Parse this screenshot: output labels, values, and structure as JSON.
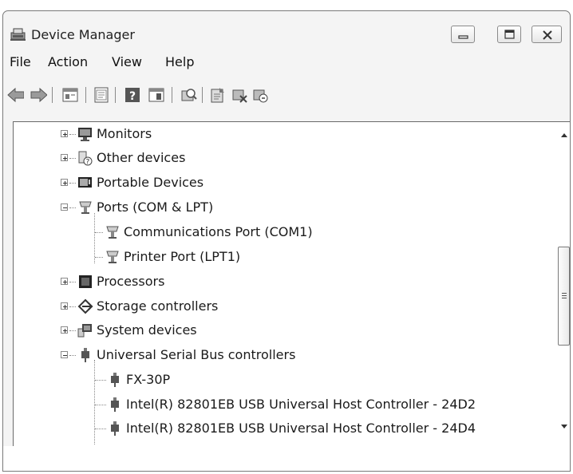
{
  "window": {
    "title": "Device Manager"
  },
  "menu": {
    "items": [
      "File",
      "Action",
      "View",
      "Help"
    ]
  },
  "toolbar": {
    "buttons": [
      "back-arrow-icon",
      "forward-arrow-icon",
      "up-level-icon",
      "properties-icon",
      "help-icon",
      "show-hide-icon",
      "scan-hardware-icon",
      "update-driver-icon",
      "disable-device-icon",
      "uninstall-device-icon"
    ]
  },
  "tree": {
    "rows": [
      {
        "label": "Monitors",
        "icon": "monitor-icon",
        "expanded": false
      },
      {
        "label": "Other devices",
        "icon": "unknown-device-icon",
        "expanded": false
      },
      {
        "label": "Portable Devices",
        "icon": "portable-device-icon",
        "expanded": false
      },
      {
        "label": "Ports (COM & LPT)",
        "icon": "port-icon",
        "expanded": true
      },
      {
        "label": "Communications Port (COM1)",
        "icon": "port-icon",
        "child": true
      },
      {
        "label": "Printer Port (LPT1)",
        "icon": "port-icon",
        "child": true
      },
      {
        "label": "Processors",
        "icon": "processor-icon",
        "expanded": false
      },
      {
        "label": "Storage controllers",
        "icon": "storage-controller-icon",
        "expanded": false
      },
      {
        "label": "System devices",
        "icon": "system-device-icon",
        "expanded": false
      },
      {
        "label": "Universal Serial Bus controllers",
        "icon": "usb-icon",
        "expanded": true
      },
      {
        "label": "FX-30P",
        "icon": "usb-icon",
        "child": true
      },
      {
        "label": "Intel(R) 82801EB USB Universal Host Controller - 24D2",
        "icon": "usb-icon",
        "child": true
      },
      {
        "label": "Intel(R) 82801EB USB Universal Host Controller - 24D4",
        "icon": "usb-icon",
        "child": true
      }
    ]
  }
}
